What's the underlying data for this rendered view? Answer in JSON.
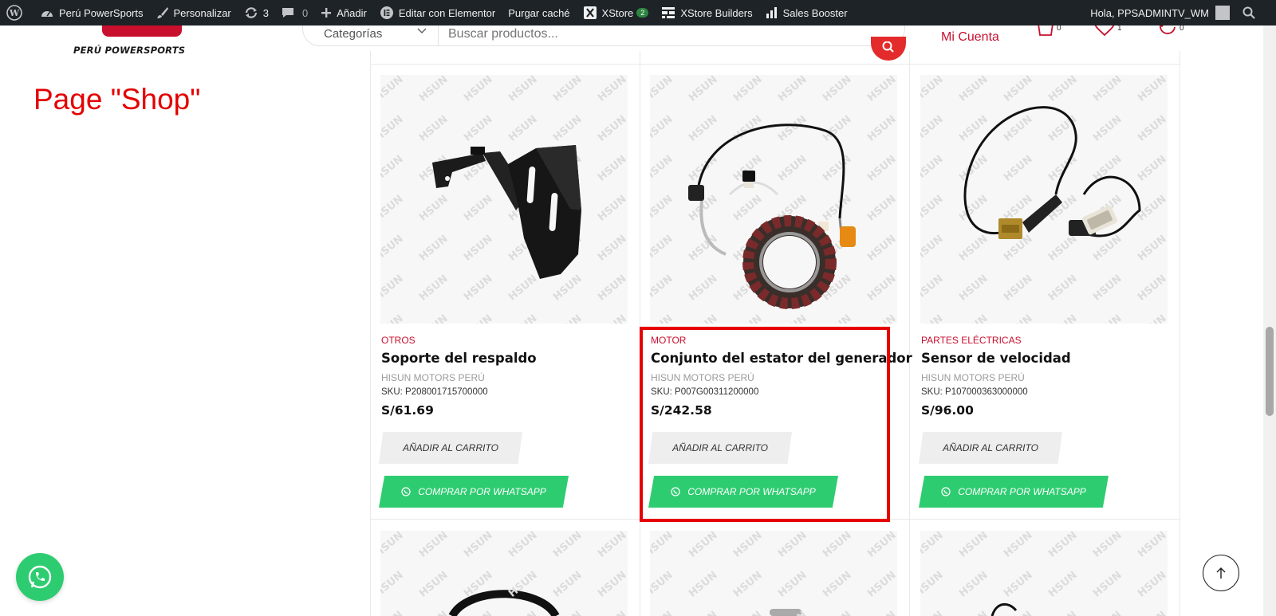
{
  "admin_bar": {
    "site_name": "Perú PowerSports",
    "customize": "Personalizar",
    "updates_count": "3",
    "comments_count": "0",
    "add_new": "Añadir",
    "edit_elementor": "Editar con Elementor",
    "purge_cache": "Purgar caché",
    "xstore": "XStore",
    "xstore_badge": "2",
    "xstore_builders": "XStore Builders",
    "sales_booster": "Sales Booster",
    "greeting": "Hola, PPSADMINTV_WM"
  },
  "header": {
    "logo_text": "PERÚ POWERSPORTS",
    "category_select": "Categorías",
    "search_placeholder": "Buscar productos...",
    "account_label": "Mi Cuenta",
    "cart_count": "0",
    "wishlist_count": "1",
    "compare_count": "0"
  },
  "annotation": {
    "page_label": "Page \"Shop\""
  },
  "products": [
    {
      "category": "OTROS",
      "name": "Soporte del respaldo",
      "brand": "HISUN MOTORS PERÚ",
      "sku": "SKU: P208001715700000",
      "price": "S/61.69",
      "cart_button": "AÑADIR AL CARRITO",
      "whatsapp_button": "COMPRAR POR WHATSAPP"
    },
    {
      "category": "MOTOR",
      "name": "Conjunto del estator del generador",
      "brand": "HISUN MOTORS PERÚ",
      "sku": "SKU: P007G00311200000",
      "price": "S/242.58",
      "cart_button": "AÑADIR AL CARRITO",
      "whatsapp_button": "COMPRAR POR WHATSAPP"
    },
    {
      "category": "PARTES ELÉCTRICAS",
      "name": "Sensor de velocidad",
      "brand": "HISUN MOTORS PERÚ",
      "sku": "SKU: P107000363000000",
      "price": "S/96.00",
      "cart_button": "AÑADIR AL CARRITO",
      "whatsapp_button": "COMPRAR POR WHATSAPP"
    }
  ],
  "watermark_text": "HSUN",
  "colors": {
    "admin_bar": "#1d2327",
    "brand_red": "#c8102e",
    "whatsapp_green": "#2ecc71",
    "highlight": "#e60000"
  }
}
